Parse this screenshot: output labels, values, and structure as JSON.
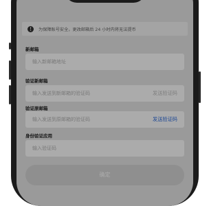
{
  "notice": {
    "text": "为保障账号安全，更改邮箱后 24 小时内将无法提币",
    "icon": "info-icon"
  },
  "form": {
    "new_email": {
      "label": "新邮箱",
      "placeholder": "输入新邮箱地址"
    },
    "verify_new": {
      "label": "验证新邮箱",
      "placeholder": "输入发送到新邮箱的验证码",
      "send_label": "发送验证码"
    },
    "verify_old": {
      "label": "验证原邮箱",
      "placeholder": "输入发送到原邮箱的验证码",
      "send_label": "发送验证码"
    },
    "authenticator": {
      "label": "身份验证应用",
      "placeholder": "输入验证码"
    },
    "confirm_label": "确定"
  },
  "colors": {
    "link": "#2f6dde",
    "disabled_text": "#bdbdbd",
    "button_disabled": "#d6d6d6"
  }
}
